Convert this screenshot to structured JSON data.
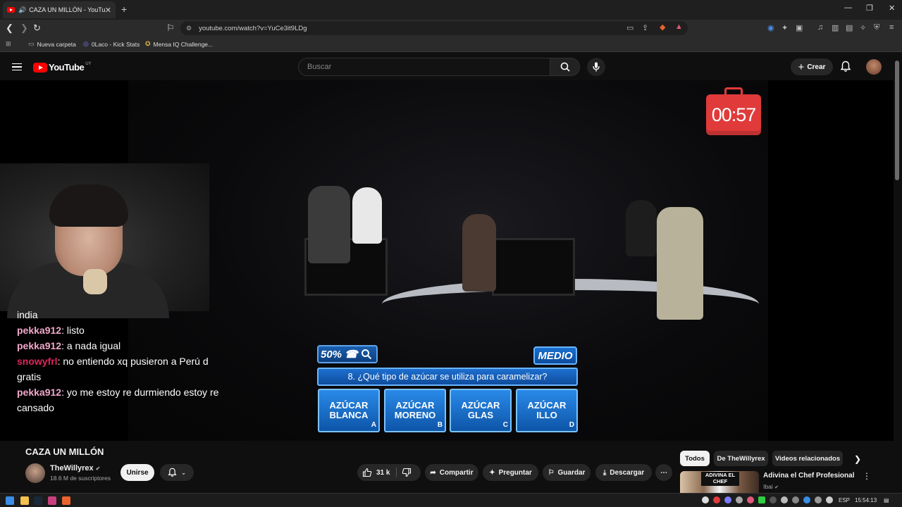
{
  "browser": {
    "tab_title": "CAZA UN MILLÓN - YouTube",
    "tab_close": "✕",
    "new_tab": "+",
    "url": "youtube.com/watch?v=YuCe3it9LDg",
    "bookmarks": [
      {
        "label": "Nueva carpeta",
        "icon": "folder-icon"
      },
      {
        "label": "0Laco - Kick Stats",
        "icon": "kick-icon"
      },
      {
        "label": "Mensa IQ Challenge...",
        "icon": "mensa-icon"
      }
    ]
  },
  "youtube": {
    "logo": "YouTube",
    "country": "UY",
    "search_placeholder": "Buscar",
    "create_label": "Crear"
  },
  "video": {
    "timer": "00:57",
    "lifeline": "50%",
    "difficulty": "MEDIO",
    "question": "8. ¿Qué tipo de azúcar se utiliza para caramelizar?",
    "answers": [
      {
        "line1": "AZÚCAR",
        "line2": "BLANCA",
        "letter": "A"
      },
      {
        "line1": "AZÚCAR",
        "line2": "MORENO",
        "letter": "B"
      },
      {
        "line1": "AZÚCAR",
        "line2": "GLAS",
        "letter": "C"
      },
      {
        "line1": "AZÚCAR",
        "line2": "ILLO",
        "letter": "D"
      }
    ],
    "chat": [
      {
        "user": "",
        "text": "india",
        "color": "#ffffff"
      },
      {
        "user": "pekka912",
        "text": ": listo",
        "color": "#f3a7c9"
      },
      {
        "user": "pekka912",
        "text": ": a nada igual",
        "color": "#f3a7c9"
      },
      {
        "user": "snowyfrl",
        "text": ": no entiendo xq pusieron a Perú d gratis",
        "color": "#e0245e"
      },
      {
        "user": "pekka912",
        "text": ": yo me estoy re durmiendo estoy re cansado",
        "color": "#f3a7c9"
      }
    ]
  },
  "below": {
    "title": "CAZA UN MILLÓN",
    "channel": "TheWillyrex",
    "subscribers": "18.6 M de suscriptores",
    "join": "Unirse",
    "likes": "31 k",
    "share": "Compartir",
    "ask": "Preguntar",
    "save": "Guardar",
    "download": "Descargar"
  },
  "sidebar": {
    "chips": [
      "Todos",
      "De TheWillyrex",
      "Videos relacionados"
    ],
    "rec_title": "Adivina el Chef Profesional",
    "rec_channel": "Ibai",
    "thumb_text": "ADIVINA EL CHEF"
  },
  "taskbar": {
    "lang": "ESP",
    "time": "15:54:13"
  }
}
